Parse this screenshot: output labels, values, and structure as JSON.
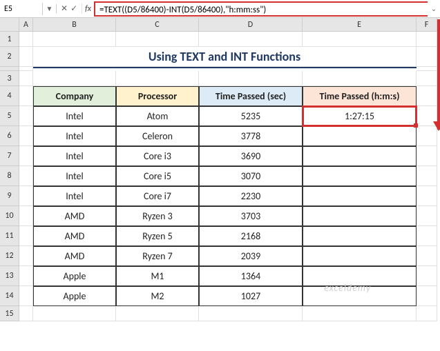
{
  "name_box": "E5",
  "formula": "=TEXT((D5/86400)-INT(D5/86400),\"h:mm:ss\")",
  "columns": [
    "A",
    "B",
    "C",
    "D",
    "E",
    "F"
  ],
  "title": "Using TEXT and INT Functions",
  "headers": {
    "company": "Company",
    "processor": "Processor",
    "time_sec": "Time Passed (sec)",
    "time_hms": "Time Passed (h:m:s)"
  },
  "rows": [
    {
      "n": "1"
    },
    {
      "n": "2"
    },
    {
      "n": "3"
    },
    {
      "n": "4"
    },
    {
      "n": "5",
      "b": "Intel",
      "c": "Atom",
      "d": "5235",
      "e": "1:27:15"
    },
    {
      "n": "6",
      "b": "Intel",
      "c": "Celeron",
      "d": "3778",
      "e": ""
    },
    {
      "n": "7",
      "b": "Intel",
      "c": "Core i3",
      "d": "3690",
      "e": ""
    },
    {
      "n": "8",
      "b": "Intel",
      "c": "Core i5",
      "d": "3070",
      "e": ""
    },
    {
      "n": "9",
      "b": "Intel",
      "c": "Core i7",
      "d": "2230",
      "e": ""
    },
    {
      "n": "10",
      "b": "AMD",
      "c": "Ryzen 3",
      "d": "3703",
      "e": ""
    },
    {
      "n": "11",
      "b": "AMD",
      "c": "Ryzen 5",
      "d": "2168",
      "e": ""
    },
    {
      "n": "12",
      "b": "AMD",
      "c": "Ryzen 7",
      "d": "2039",
      "e": ""
    },
    {
      "n": "13",
      "b": "Apple",
      "c": "M1",
      "d": "1364",
      "e": ""
    },
    {
      "n": "14",
      "b": "Apple",
      "c": "M2",
      "d": "1027",
      "e": ""
    },
    {
      "n": "15"
    }
  ],
  "watermark": "exceldemy"
}
